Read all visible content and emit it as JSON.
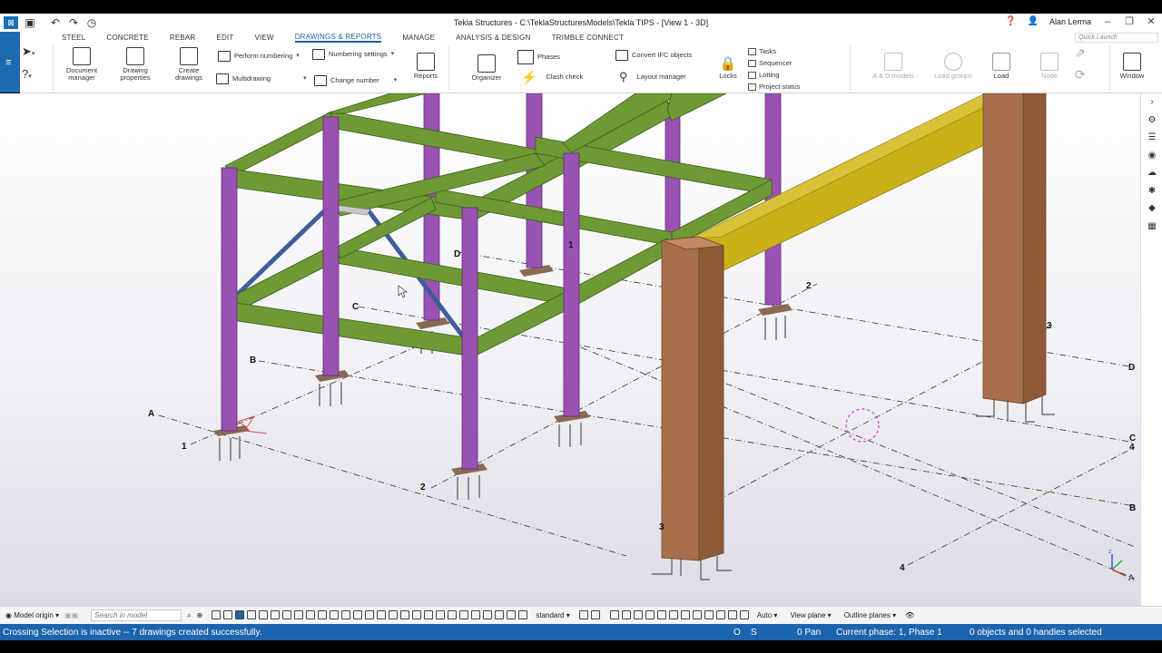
{
  "window": {
    "title": "Tekla Structures - C:\\TeklaStructuresModels\\Tekla TIPS  - [View 1 - 3D]",
    "user": "Alan Lerma"
  },
  "tabs": [
    "STEEL",
    "CONCRETE",
    "REBAR",
    "EDIT",
    "VIEW",
    "DRAWINGS & REPORTS",
    "MANAGE",
    "ANALYSIS & DESIGN",
    "TRIMBLE CONNECT"
  ],
  "active_tab": "DRAWINGS & REPORTS",
  "quick_launch_placeholder": "Quick Launch",
  "ribbon": {
    "document_manager": "Document manager",
    "drawing_properties": "Drawing properties",
    "create_drawings": "Create drawings",
    "perform_numbering": "Perform numbering",
    "multidrawing": "Multidrawing",
    "numbering_settings": "Numbering settings",
    "change_number": "Change number",
    "reports": "Reports",
    "organizer": "Organizer",
    "phases": "Phases",
    "clash_check": "Clash check",
    "convert_ifc": "Convert IFC objects",
    "layout_manager": "Layout manager",
    "locks": "Locks",
    "tasks": "Tasks",
    "sequencer": "Sequencer",
    "lotting": "Lotting",
    "project_status": "Project status",
    "ad_models": "A & D models",
    "load_groups": "Load groups",
    "load": "Load",
    "node": "Node",
    "window": "Window"
  },
  "grid_labels": {
    "left": [
      "A",
      "B",
      "C",
      "D",
      "1",
      "2",
      "1",
      "2"
    ],
    "right": [
      "2",
      "3",
      "D",
      "C",
      "4",
      "B",
      "A",
      "3",
      "4"
    ]
  },
  "colors": {
    "beam_green": "#6e9a35",
    "column_purple": "#9a52b2",
    "brace_blue": "#3e5e9a",
    "yellow_beam": "#c9b11a",
    "concrete_column": "#a8704a",
    "status_blue": "#1c64ad"
  },
  "bottom_toolbar": {
    "model_origin": "Model origin",
    "search_placeholder": "Search in model",
    "standard": "standard",
    "auto": "Auto",
    "view_plane": "View plane",
    "outline_planes": "Outline planes"
  },
  "status": {
    "message": "Crossing Selection is inactive -- 7 drawings created successfully.",
    "o": "O",
    "s": "S",
    "pan": "0 Pan",
    "phase": "Current phase: 1, Phase 1",
    "selection": "0 objects and 0 handles selected"
  }
}
